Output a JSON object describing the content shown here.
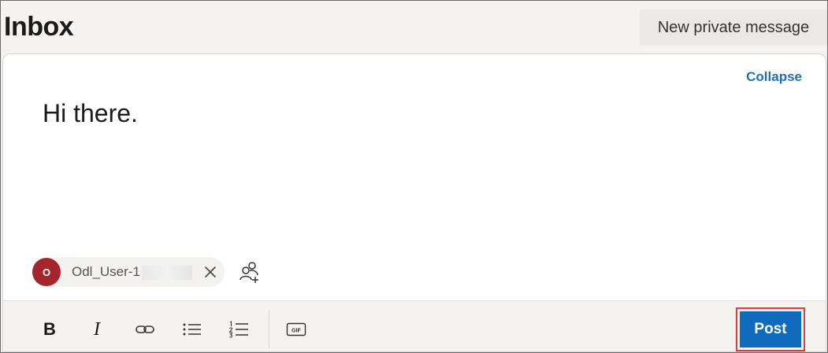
{
  "header": {
    "title": "Inbox",
    "new_message_label": "New private message"
  },
  "composer": {
    "collapse_label": "Collapse",
    "message_text": "Hi there.",
    "recipient": {
      "avatar_initial": "O",
      "name": "Odl_User-1",
      "name_partially_obscured": true
    },
    "toolbar": {
      "bold_label": "B",
      "italic_label": "I",
      "icons": [
        "link-icon",
        "bulleted-list-icon",
        "numbered-list-icon",
        "gif-icon"
      ]
    },
    "post_label": "Post"
  },
  "colors": {
    "accent": "#0f6cbd",
    "link": "#1f6fb5",
    "avatar": "#a4262c",
    "highlight_outline": "#e03b3b"
  }
}
